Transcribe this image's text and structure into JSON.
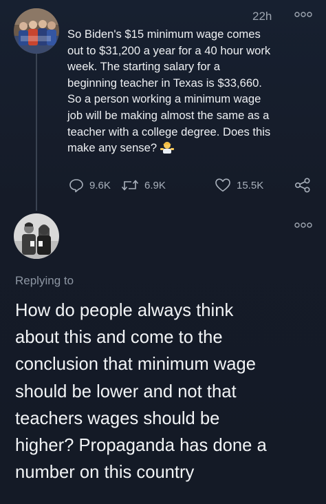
{
  "tweet": {
    "timestamp": "22h",
    "text": "So Biden's $15 minimum wage comes\nout to $31,200 a year for a 40 hour work\nweek. The starting salary for a\nbeginning teacher in Texas is $33,660.\nSo a person working a minimum wage\njob will be making almost the same as a\nteacher with a college degree. Does this\nmake any sense?",
    "emoji": "person-shrugging",
    "actions": {
      "replies": "9.6K",
      "retweets": "6.9K",
      "likes": "15.5K"
    }
  },
  "reply": {
    "replying_to": "Replying to",
    "text": "How do people always think\nabout this and come to the\nconclusion that minimum wage\nshould be lower and not that\nteachers wages should be\nhigher? Propaganda has done a\nnumber on this country"
  },
  "icons": {
    "more": "more-horizontal-icon",
    "reply": "reply-icon",
    "retweet": "retweet-icon",
    "like": "heart-icon",
    "share": "share-icon"
  },
  "colors": {
    "background": "#151b28",
    "text": "#eef0f3",
    "muted": "#a9b1bc",
    "thread_line": "#3a4352"
  }
}
